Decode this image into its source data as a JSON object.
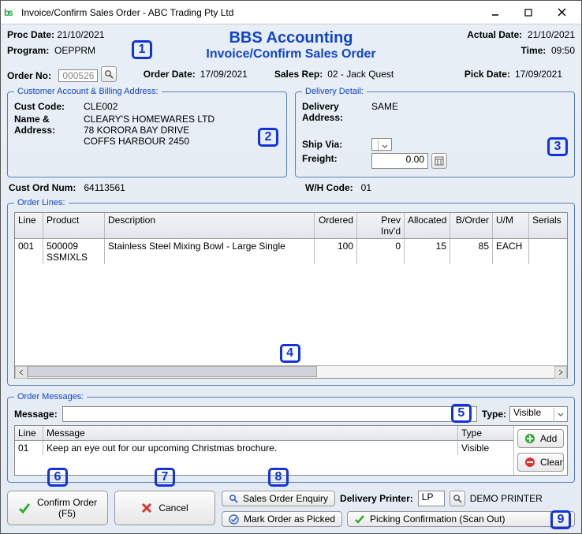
{
  "window": {
    "title": "Invoice/Confirm Sales Order - ABC Trading Pty Ltd"
  },
  "header": {
    "procDateLabel": "Proc Date:",
    "procDate": "21/10/2021",
    "programLabel": "Program:",
    "program": "OEPPRM",
    "companyName": "BBS Accounting",
    "subtitle": "Invoice/Confirm Sales Order",
    "actualDateLabel": "Actual Date:",
    "actualDate": "21/10/2021",
    "timeLabel": "Time:",
    "time": "09:50"
  },
  "orderbar": {
    "orderNoLabel": "Order No:",
    "orderNo": "000526",
    "orderDateLabel": "Order Date:",
    "orderDate": "17/09/2021",
    "salesRepLabel": "Sales Rep:",
    "salesRep": "02 - Jack Quest",
    "pickDateLabel": "Pick Date:",
    "pickDate": "17/09/2021"
  },
  "customer": {
    "legend": "Customer Account & Billing Address:",
    "custCodeLabel": "Cust Code:",
    "custCode": "CLE002",
    "nameAddrLabel": "Name & Address:",
    "name": "CLEARY'S HOMEWARES LTD",
    "addr1": "78 KORORA BAY DRIVE",
    "addr2": "COFFS HARBOUR 2450"
  },
  "delivery": {
    "legend": "Delivery Detail:",
    "addrLabel": "Delivery Address:",
    "addr": "SAME",
    "shipViaLabel": "Ship Via:",
    "shipVia": "",
    "freightLabel": "Freight:",
    "freight": "0.00"
  },
  "extra": {
    "custOrdLabel": "Cust Ord Num:",
    "custOrd": "64113561",
    "whLabel": "W/H Code:",
    "wh": "01"
  },
  "lines": {
    "legend": "Order Lines:",
    "cols": {
      "line": "Line",
      "product": "Product",
      "desc": "Description",
      "ord": "Ordered",
      "prev": "Prev Inv'd",
      "alloc": "Allocated",
      "bo": "B/Order",
      "um": "U/M",
      "ser": "Serials"
    },
    "rows": [
      {
        "line": "001",
        "product": "500009 SSMIXLS",
        "desc": "Stainless Steel Mixing Bowl - Large Single",
        "ord": "100",
        "prev": "0",
        "alloc": "15",
        "bo": "85",
        "um": "EACH",
        "ser": ""
      }
    ]
  },
  "messages": {
    "legend": "Order Messages:",
    "msgLabel": "Message:",
    "msg": "",
    "typeLabel": "Type:",
    "type": "Visible",
    "cols": {
      "line": "Line",
      "msg": "Message",
      "type": "Type"
    },
    "rows": [
      {
        "line": "01",
        "msg": "Keep an eye out for our upcoming Christmas brochure.",
        "type": "Visible"
      }
    ],
    "addLabel": "Add",
    "clearLabel": "Clear"
  },
  "buttons": {
    "confirm1": "Confirm Order",
    "confirm2": "(F5)",
    "cancel": "Cancel",
    "soe": "Sales Order Enquiry",
    "picked": "Mark Order as Picked",
    "dpLabel": "Delivery Printer:",
    "dp": "LP",
    "dpName": "DEMO PRINTER",
    "scanOut": "Picking Confirmation (Scan Out)"
  },
  "callouts": {
    "1": "1",
    "2": "2",
    "3": "3",
    "4": "4",
    "5": "5",
    "6": "6",
    "7": "7",
    "8": "8",
    "9": "9"
  }
}
